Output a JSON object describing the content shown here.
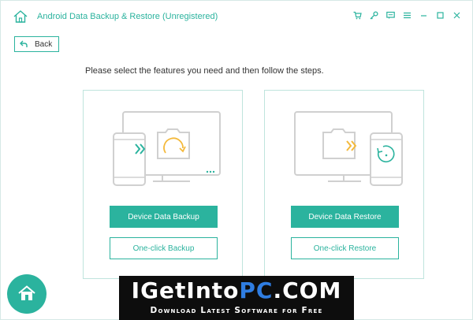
{
  "window": {
    "title": "Android Data Backup & Restore (Unregistered)",
    "accent_color": "#2bb39e",
    "controls": [
      "cart-icon",
      "key-icon",
      "feedback-icon",
      "menu-icon",
      "minimize-icon",
      "maximize-icon",
      "close-icon"
    ]
  },
  "nav": {
    "back_label": "Back"
  },
  "main": {
    "instructions": "Please select the features you need and then follow the steps."
  },
  "cards": [
    {
      "id": "backup",
      "primary_label": "Device Data Backup",
      "secondary_label": "One-click Backup"
    },
    {
      "id": "restore",
      "primary_label": "Device Data Restore",
      "secondary_label": "One-click Restore"
    }
  ],
  "watermark": {
    "part1": "IGetInto",
    "part2": "PC",
    "part3": ".COM",
    "subtitle": "Download Latest Software for Free"
  }
}
